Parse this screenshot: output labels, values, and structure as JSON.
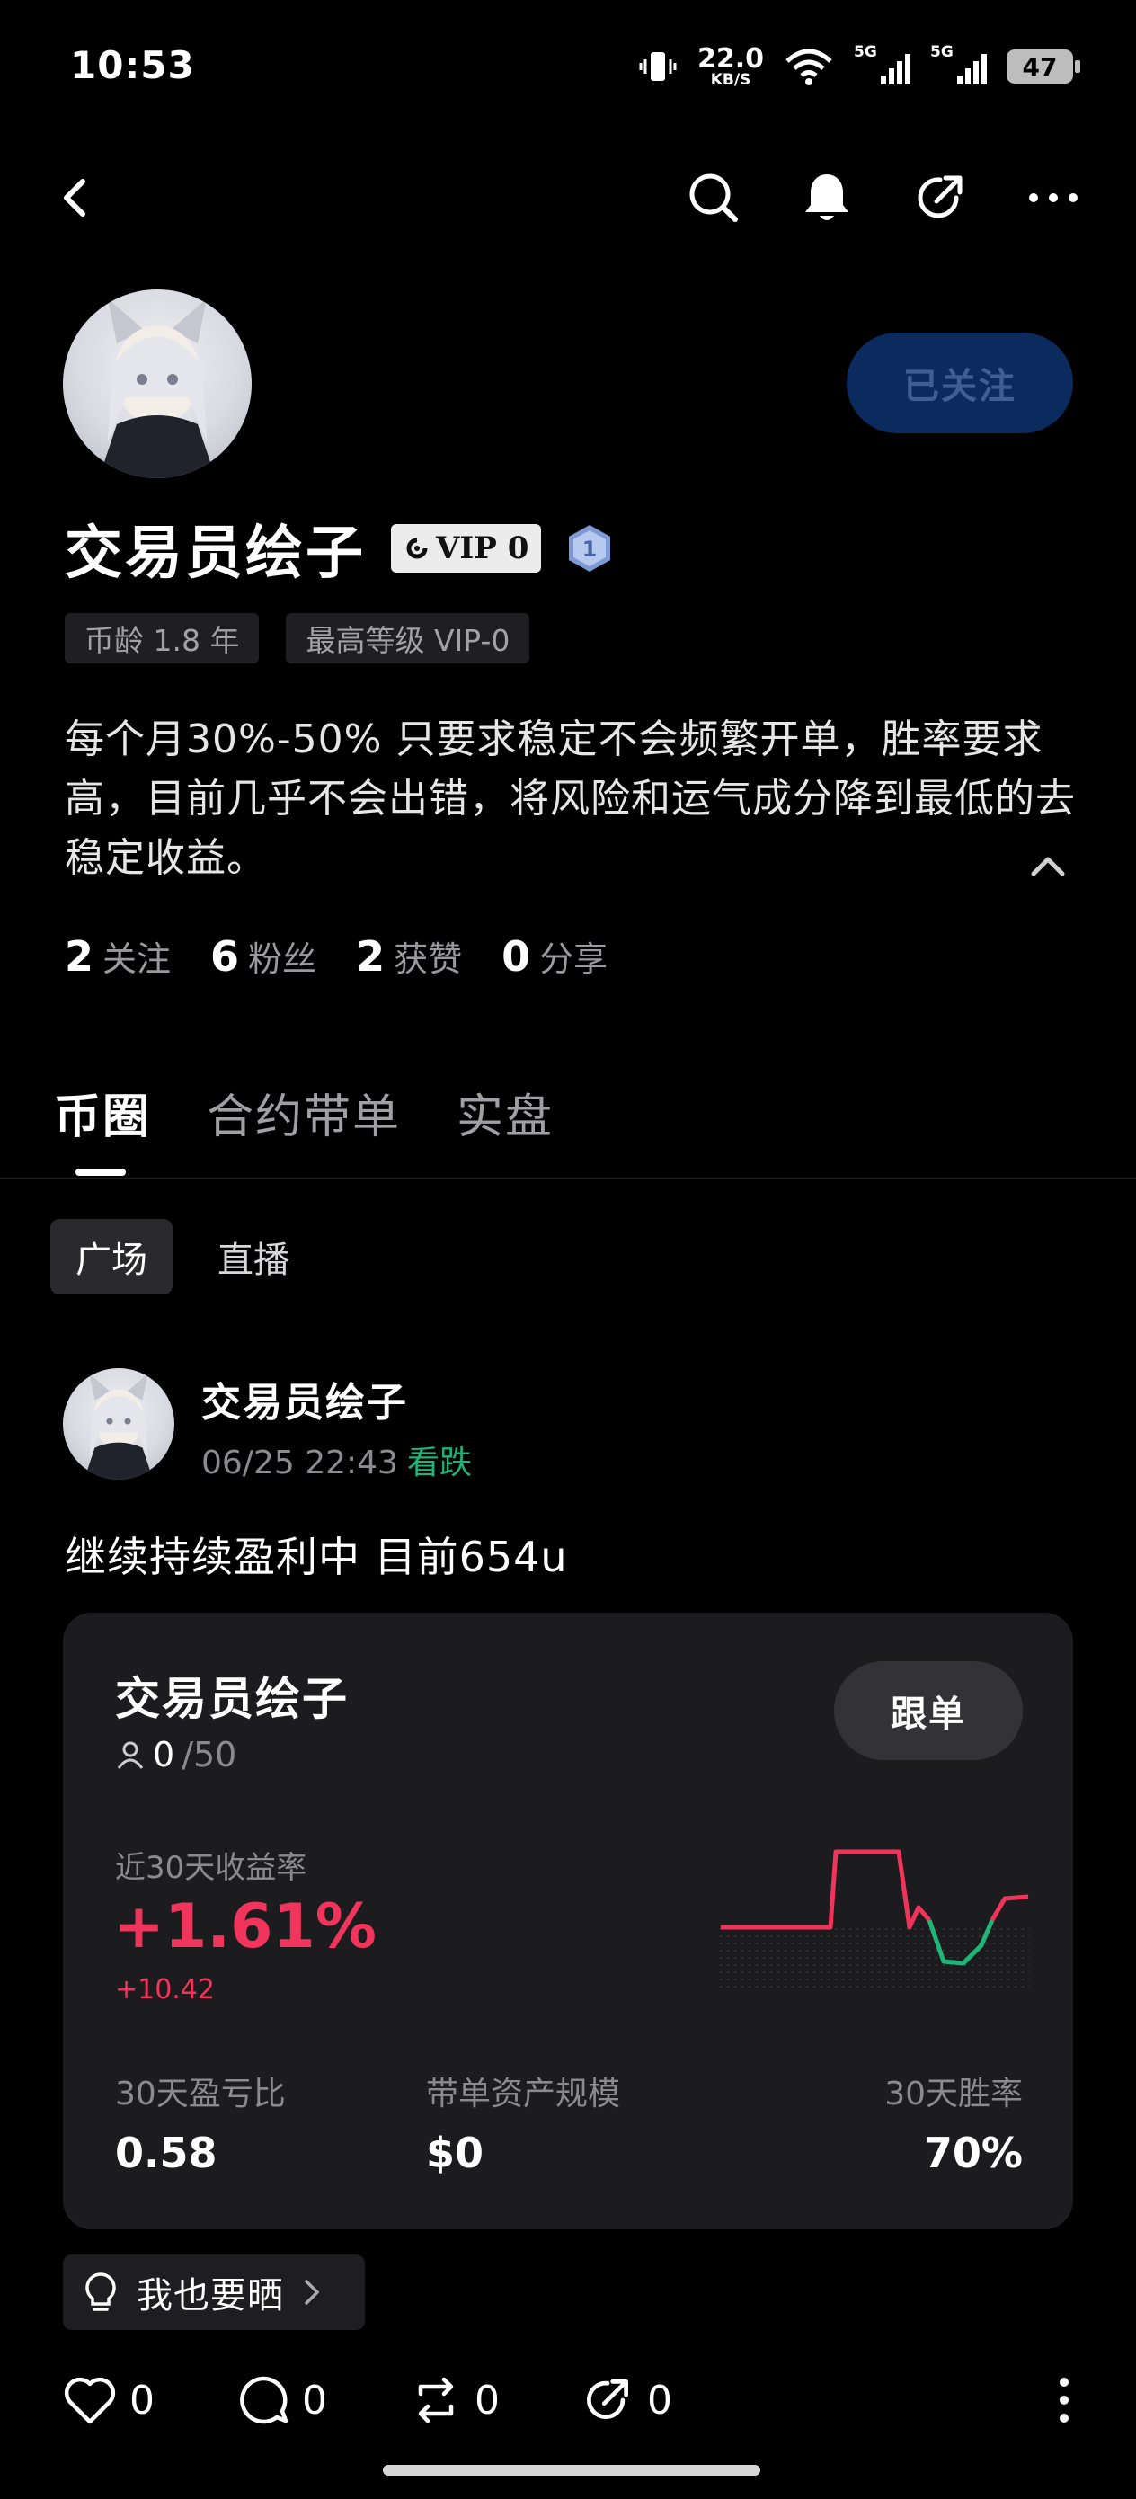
{
  "status_bar": {
    "time": "10:53",
    "net_speed_value": "22.0",
    "net_speed_unit": "KB/S",
    "sim1_tag": "5G",
    "sim2_tag": "5G",
    "battery": "47",
    "icons": [
      "vibrate-icon",
      "wifi-icon",
      "signal-icon",
      "battery-icon"
    ]
  },
  "nav": {
    "icons": [
      "back-icon",
      "search-icon",
      "bell-icon",
      "share-icon",
      "more-icon"
    ]
  },
  "profile": {
    "name": "交易员绘子",
    "vip_label": "VIP 0",
    "level": "1",
    "follow_button": "已关注",
    "tags": [
      "币龄 1.8 年",
      "最高等级 VIP-0"
    ],
    "bio": "每个月30%-50% 只要求稳定不会频繁开单，胜率要求高，目前几乎不会出错，将风险和运气成分降到最低的去稳定收益。",
    "stats": [
      {
        "num": "2",
        "label": "关注"
      },
      {
        "num": "6",
        "label": "粉丝"
      },
      {
        "num": "2",
        "label": "获赞"
      },
      {
        "num": "0",
        "label": "分享"
      }
    ]
  },
  "tabs": [
    {
      "label": "币圈",
      "active": true
    },
    {
      "label": "合约带单",
      "active": false
    },
    {
      "label": "实盘",
      "active": false
    }
  ],
  "subtabs": [
    {
      "label": "广场",
      "active": true
    },
    {
      "label": "直播",
      "active": false
    }
  ],
  "post": {
    "author": "交易员绘子",
    "datetime": "06/25 22:43",
    "trend": "看跌",
    "text": "继续持续盈利中 目前654u",
    "card": {
      "name": "交易员绘子",
      "follow_button": "跟单",
      "followers_current": "0",
      "followers_max": "/50",
      "roi_label": "近30天收益率",
      "roi": "+1.61%",
      "roi_sub": "+10.42",
      "metrics": [
        {
          "label": "30天盈亏比",
          "value": "0.58"
        },
        {
          "label": "带单资产规模",
          "value": "$0"
        },
        {
          "label": "30天胜率",
          "value": "70%"
        }
      ],
      "colors": {
        "up": "#f0345c",
        "down": "#1fb478"
      }
    },
    "share_chip": "我也要晒",
    "actions": [
      {
        "icon": "heart-icon",
        "count": "0"
      },
      {
        "icon": "comment-icon",
        "count": "0"
      },
      {
        "icon": "repost-icon",
        "count": "0"
      },
      {
        "icon": "forward-icon",
        "count": "0"
      }
    ]
  }
}
